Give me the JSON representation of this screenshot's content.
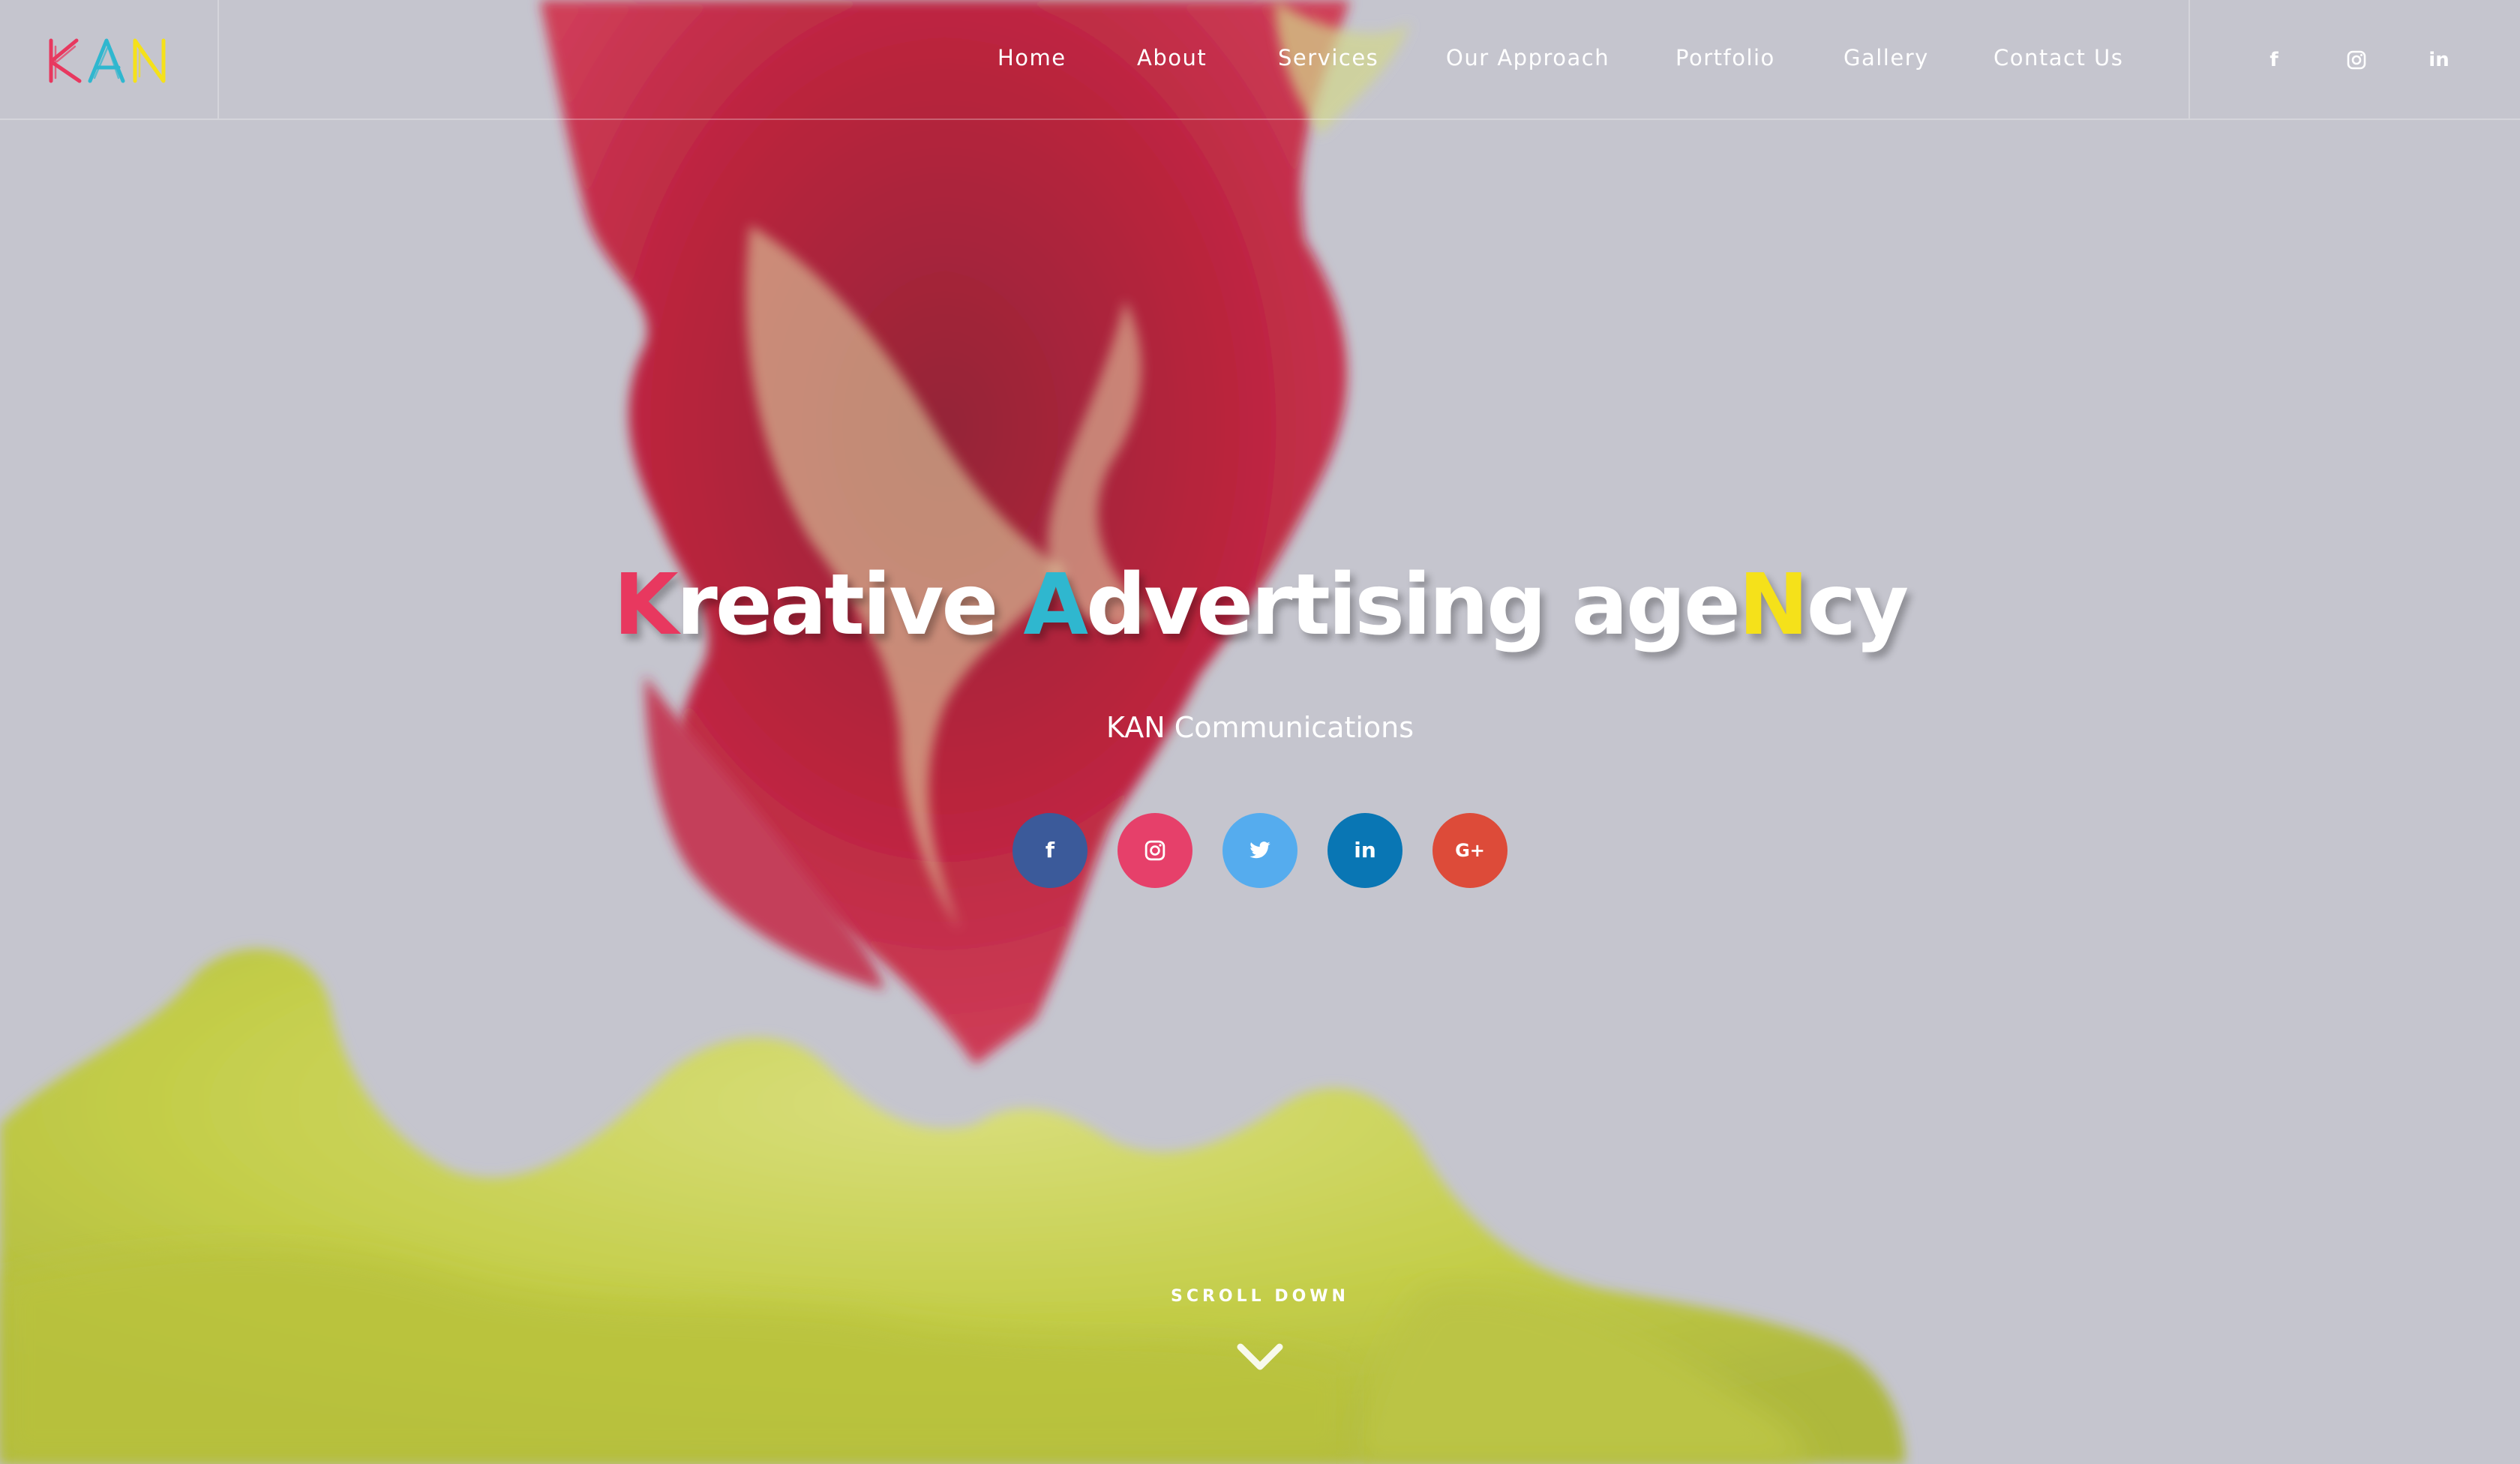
{
  "brand": {
    "logo_text": "KAN",
    "logo_colors": [
      "#e8385f",
      "#2fb7cf",
      "#f5e11a"
    ]
  },
  "nav": {
    "items": [
      {
        "label": "Home"
      },
      {
        "label": "About"
      },
      {
        "label": "Services"
      },
      {
        "label": "Our Approach"
      },
      {
        "label": "Portfolio"
      },
      {
        "label": "Gallery"
      },
      {
        "label": "Contact Us"
      }
    ]
  },
  "header_social": [
    {
      "icon": "facebook-icon",
      "glyph": "f"
    },
    {
      "icon": "instagram-icon",
      "glyph": ""
    },
    {
      "icon": "linkedin-icon",
      "glyph": "in"
    }
  ],
  "hero": {
    "title_parts": [
      {
        "text": "K",
        "highlight": "k"
      },
      {
        "text": "reative ",
        "highlight": ""
      },
      {
        "text": "A",
        "highlight": "a"
      },
      {
        "text": "dvertising age",
        "highlight": ""
      },
      {
        "text": "N",
        "highlight": "n"
      },
      {
        "text": "cy",
        "highlight": ""
      }
    ],
    "subtitle": "KAN Communications",
    "social_buttons": [
      {
        "icon": "facebook-icon",
        "glyph": "f",
        "color": "#3b5a9a"
      },
      {
        "icon": "instagram-icon",
        "glyph": "",
        "color": "#e6406a"
      },
      {
        "icon": "twitter-icon",
        "glyph": "",
        "color": "#55acee"
      },
      {
        "icon": "linkedin-icon",
        "glyph": "in",
        "color": "#0976b4"
      },
      {
        "icon": "google-plus-icon",
        "glyph": "G+",
        "color": "#dd4b39"
      }
    ]
  },
  "scroll": {
    "label": "SCROLL DOWN",
    "icon": "chevron-down-icon"
  },
  "colors": {
    "background": "#c4c4cd",
    "ink_red": "#b5001e",
    "ink_yellow": "#c5d12a"
  }
}
